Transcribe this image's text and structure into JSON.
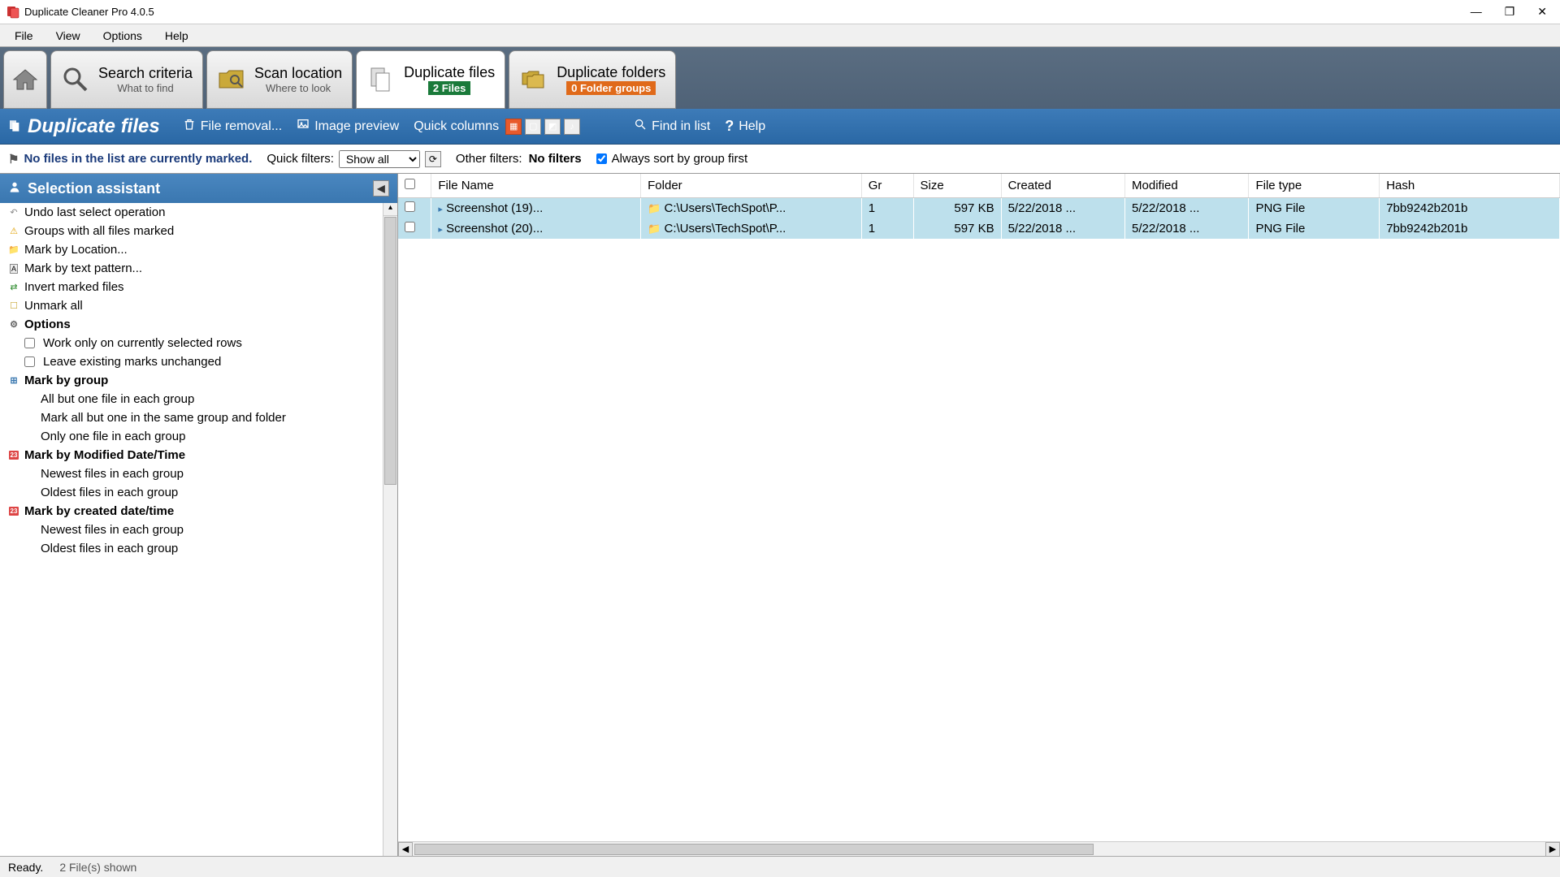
{
  "window": {
    "title": "Duplicate Cleaner Pro 4.0.5"
  },
  "menu": [
    "File",
    "View",
    "Options",
    "Help"
  ],
  "tabs": {
    "home": {},
    "search_criteria": {
      "title": "Search criteria",
      "sub": "What to find"
    },
    "scan_location": {
      "title": "Scan location",
      "sub": "Where to look"
    },
    "duplicate_files": {
      "title": "Duplicate files",
      "badge": "2 Files"
    },
    "duplicate_folders": {
      "title": "Duplicate folders",
      "badge": "0 Folder groups"
    }
  },
  "toolbar": {
    "section_title": "Duplicate files",
    "file_removal": "File removal...",
    "image_preview": "Image preview",
    "quick_columns": "Quick columns",
    "find_in_list": "Find in list",
    "help": "Help"
  },
  "filters": {
    "marked_info": "No files in the list are currently marked.",
    "quick_filters_label": "Quick filters:",
    "quick_filters_value": "Show all",
    "other_filters_label": "Other filters:",
    "other_filters_value": "No filters",
    "sort_by_group_label": "Always sort by group first",
    "sort_by_group_checked": true
  },
  "sidebar": {
    "title": "Selection assistant",
    "items": [
      {
        "icon": "undo",
        "label": "Undo last select operation"
      },
      {
        "icon": "warn",
        "label": "Groups with all files marked"
      },
      {
        "icon": "folder",
        "label": "Mark by Location..."
      },
      {
        "icon": "text",
        "label": "Mark by text pattern..."
      },
      {
        "icon": "invert",
        "label": "Invert marked files"
      },
      {
        "icon": "unmark",
        "label": "Unmark all"
      },
      {
        "icon": "gear",
        "label": "Options",
        "heading": true
      },
      {
        "checkbox": true,
        "label": "Work only on currently selected rows",
        "indent": true
      },
      {
        "checkbox": true,
        "label": "Leave existing marks unchanged",
        "indent": true
      },
      {
        "icon": "tree",
        "label": "Mark by group",
        "heading": true
      },
      {
        "label": "All but one file in each group",
        "indent": true
      },
      {
        "label": "Mark all but one in the same group and folder",
        "indent": true
      },
      {
        "label": "Only one file in each group",
        "indent": true
      },
      {
        "icon": "cal",
        "label": "Mark by Modified Date/Time",
        "heading": true
      },
      {
        "label": "Newest files in each group",
        "indent": true
      },
      {
        "label": "Oldest files in each group",
        "indent": true
      },
      {
        "icon": "cal",
        "label": "Mark by created date/time",
        "heading": true
      },
      {
        "label": "Newest files in each group",
        "indent": true
      },
      {
        "label": "Oldest files in each group",
        "indent": true
      }
    ]
  },
  "table": {
    "columns": [
      "File Name",
      "Folder",
      "Gr",
      "Size",
      "Created",
      "Modified",
      "File type",
      "Hash"
    ],
    "rows": [
      {
        "checked": false,
        "filename": "Screenshot (19)...",
        "folder": "C:\\Users\\TechSpot\\P...",
        "group": "1",
        "size": "597 KB",
        "created": "5/22/2018 ...",
        "modified": "5/22/2018 ...",
        "filetype": "PNG File",
        "hash": "7bb9242b201b"
      },
      {
        "checked": false,
        "filename": "Screenshot (20)...",
        "folder": "C:\\Users\\TechSpot\\P...",
        "group": "1",
        "size": "597 KB",
        "created": "5/22/2018 ...",
        "modified": "5/22/2018 ...",
        "filetype": "PNG File",
        "hash": "7bb9242b201b"
      }
    ]
  },
  "statusbar": {
    "ready": "Ready.",
    "shown": "2 File(s) shown"
  }
}
